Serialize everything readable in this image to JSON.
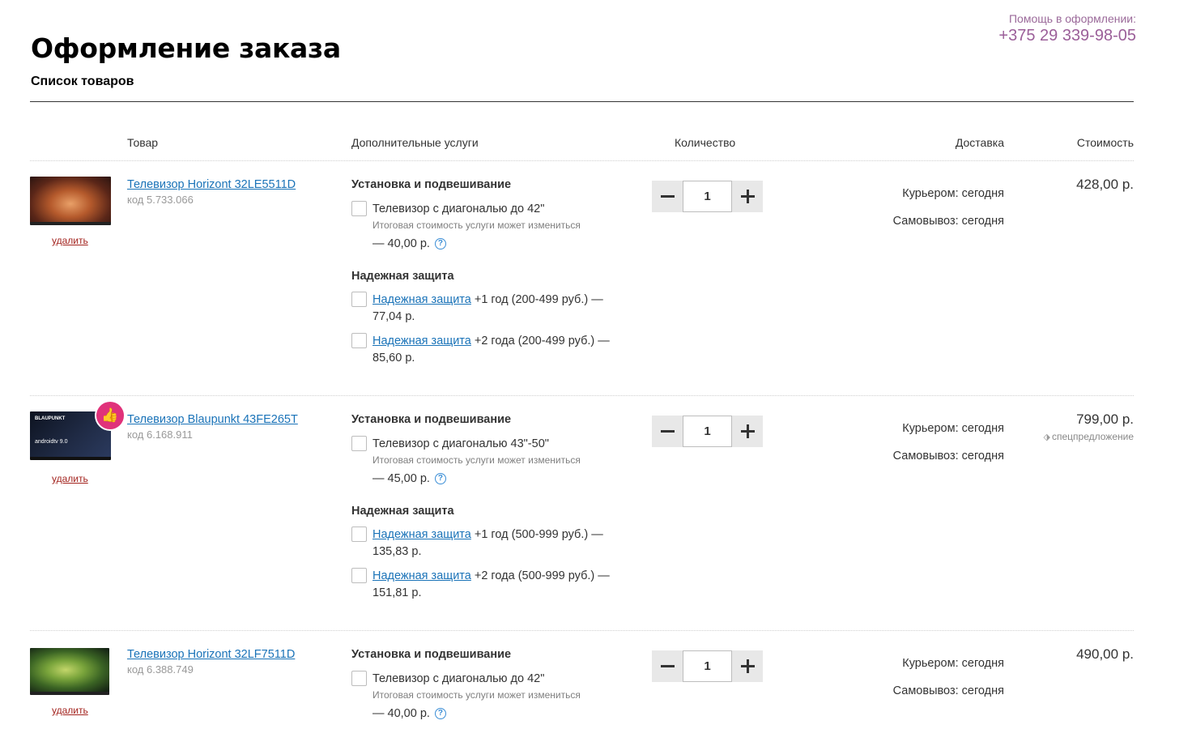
{
  "help": {
    "label": "Помощь в оформлении:",
    "phone": "+375 29 339-98-05"
  },
  "page": {
    "title": "Оформление заказа",
    "subtitle": "Список товаров"
  },
  "table_headers": {
    "product": "Товар",
    "services": "Дополнительные услуги",
    "quantity": "Количество",
    "delivery": "Доставка",
    "price": "Стоимость"
  },
  "items": [
    {
      "name": "Телевизор Horizont 32LE5511D",
      "code": "код 5.733.066",
      "remove": "удалить",
      "install_heading": "Установка и подвешивание",
      "install_option": "Телевизор с диагональю до 42\"",
      "install_note": "Итоговая стоимость услуги может измениться",
      "install_price": "— 40,00 р.",
      "protection_heading": "Надежная защита",
      "protection_options": [
        {
          "link": "Надежная защита",
          "text": " +1 год (200-499 руб.) — 77,04 р."
        },
        {
          "link": "Надежная защита",
          "text": " +2 года (200-499 руб.) — 85,60 р."
        }
      ],
      "quantity": "1",
      "delivery_courier": "Курьером: сегодня",
      "delivery_pickup": "Самовывоз: сегодня",
      "price": "428,00 р."
    },
    {
      "name": "Телевизор Blaupunkt 43FE265T",
      "code": "код 6.168.911",
      "remove": "удалить",
      "thumb_brand": "BLAUPUNKT",
      "thumb_os": "androidtv 9.0",
      "install_heading": "Установка и подвешивание",
      "install_option": "Телевизор с диагональю 43\"-50\"",
      "install_note": "Итоговая стоимость услуги может измениться",
      "install_price": "— 45,00 р.",
      "protection_heading": "Надежная защита",
      "protection_options": [
        {
          "link": "Надежная защита",
          "text": " +1 год (500-999 руб.) — 135,83 р."
        },
        {
          "link": "Надежная защита",
          "text": " +2 года (500-999 руб.) — 151,81 р."
        }
      ],
      "quantity": "1",
      "delivery_courier": "Курьером: сегодня",
      "delivery_pickup": "Самовывоз: сегодня",
      "price": "799,00 р.",
      "special": "спецпредложение"
    },
    {
      "name": "Телевизор Horizont 32LF7511D",
      "code": "код 6.388.749",
      "remove": "удалить",
      "install_heading": "Установка и подвешивание",
      "install_option": "Телевизор с диагональю до 42\"",
      "install_note": "Итоговая стоимость услуги может измениться",
      "install_price": "— 40,00 р.",
      "quantity": "1",
      "delivery_courier": "Курьером: сегодня",
      "delivery_pickup": "Самовывоз: сегодня",
      "price": "490,00 р."
    }
  ],
  "icons": {
    "help": "question-icon",
    "like_badge": "thumbs-up-icon",
    "special": "tag-icon",
    "minus": "minus-icon",
    "plus": "plus-icon"
  },
  "colors": {
    "help_text": "#9b5f99",
    "link": "#1a73b8",
    "remove_link": "#a3241f",
    "badge": "#e0327a",
    "qty_button_bg": "#e8e8e8"
  }
}
